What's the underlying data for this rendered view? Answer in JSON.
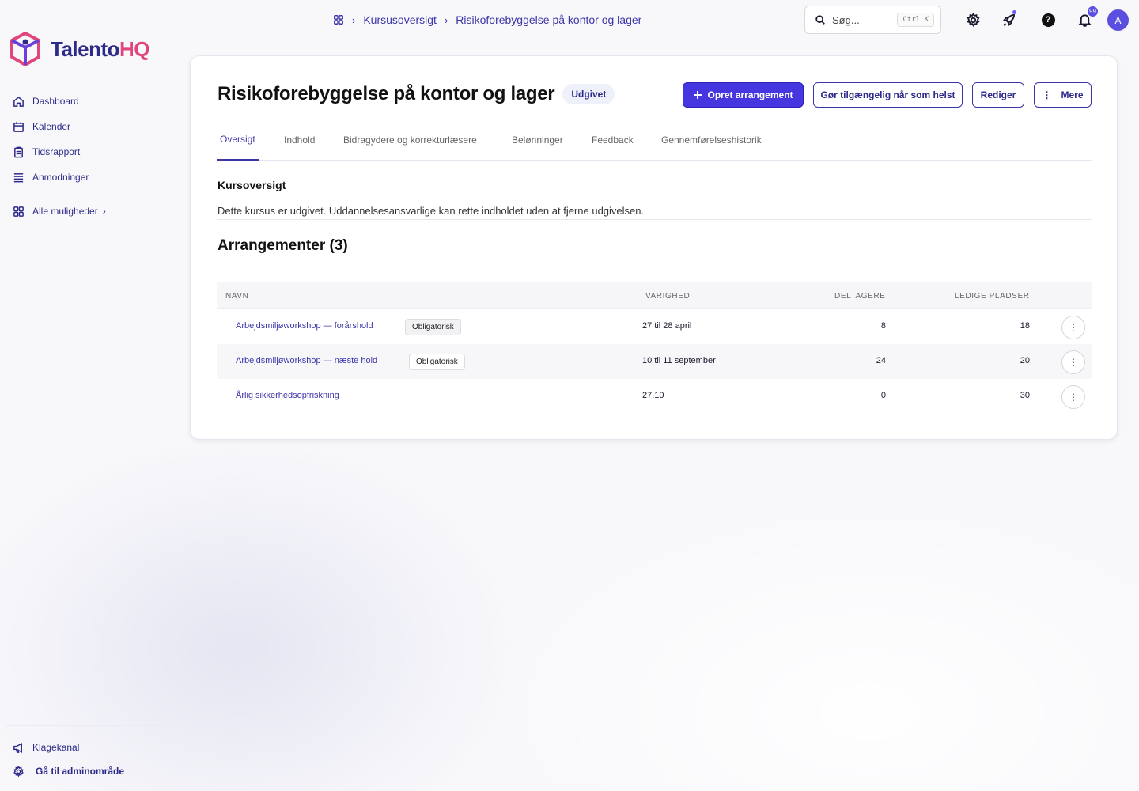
{
  "app": {
    "logo_text_1": "Talento",
    "logo_text_2": "HQ",
    "brand_color": "#2d2a8a",
    "accent_color": "#e0457b"
  },
  "sidebar": {
    "items": [
      {
        "label": "Dashboard",
        "icon": "home-icon"
      },
      {
        "label": "Kalender",
        "icon": "calendar-icon"
      },
      {
        "label": "Tidsrapport",
        "icon": "clipboard-icon"
      },
      {
        "label": "Anmodninger",
        "icon": "list-icon"
      }
    ],
    "all_options_label": "Alle muligheder",
    "bottom_items": [
      {
        "label": "Klagekanal",
        "icon": "megaphone-icon"
      },
      {
        "label": "Gå til adminområde",
        "icon": "gear-icon"
      }
    ]
  },
  "breadcrumb": {
    "items": [
      "Kursusoversigt",
      "Risikoforebyggelse på kontor og lager"
    ]
  },
  "search": {
    "placeholder": "Søg...",
    "shortcut": "Ctrl K"
  },
  "topbar": {
    "notification_count": "99",
    "avatar_initial": "A"
  },
  "page": {
    "title": "Risikoforebyggelse på kontor og lager",
    "status": "Udgivet",
    "buttons": {
      "create_event": "Opret arrangement",
      "make_available": "Gør tilgængelig når som helst",
      "edit": "Rediger",
      "more": "Mere"
    },
    "tabs": [
      "Oversigt",
      "Indhold",
      "Bidragydere og korrekturlæsere",
      "Belønninger",
      "Feedback",
      "Gennemførelseshistorik"
    ],
    "active_tab": "Oversigt",
    "overview_title": "Kursoversigt",
    "overview_text": "Dette kursus er udgivet. Uddannelsesansvarlige kan rette indholdet uden at fjerne udgivelsen.",
    "events_title": "Arrangementer (3)"
  },
  "table": {
    "columns": [
      "NAVN",
      "VARIGHED",
      "DELTAGERE",
      "LEDIGE PLADSER"
    ],
    "rows": [
      {
        "name": "Arbejdsmiljøworkshop — forårshold",
        "tag": "Obligatorisk",
        "duration": "27 til 28 april",
        "participants": "8",
        "free_seats": "18"
      },
      {
        "name": "Arbejdsmiljøworkshop — næste hold",
        "tag": "Obligatorisk",
        "duration": "10 til 11 september",
        "participants": "24",
        "free_seats": "20"
      },
      {
        "name": "Årlig sikkerhedsopfriskning",
        "tag": "",
        "duration": "27.10",
        "participants": "0",
        "free_seats": "30"
      }
    ]
  }
}
